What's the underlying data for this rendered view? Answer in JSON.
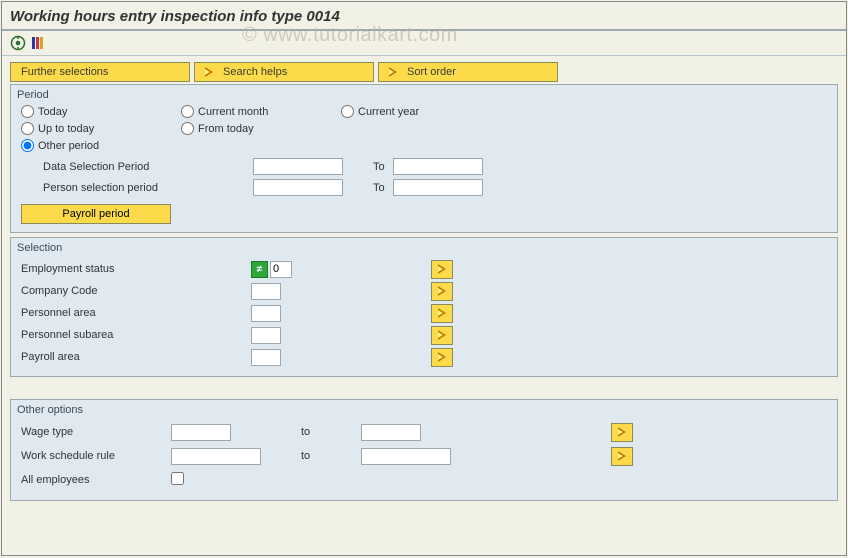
{
  "title": "Working hours entry inspection info type 0014",
  "watermark": "© www.tutorialkart.com",
  "buttons": {
    "further": "Further selections",
    "search_helps": "Search helps",
    "sort_order": "Sort order",
    "payroll": "Payroll period"
  },
  "period": {
    "legend": "Period",
    "today": "Today",
    "current_month": "Current month",
    "current_year": "Current year",
    "up_to_today": "Up to today",
    "from_today": "From today",
    "other_period": "Other period",
    "data_sel": "Data Selection Period",
    "person_sel": "Person selection period",
    "to": "To",
    "selected": "other_period"
  },
  "selection": {
    "legend": "Selection",
    "rows": [
      {
        "label": "Employment status",
        "value": "0",
        "neq": true,
        "arrow": "single"
      },
      {
        "label": "Company Code",
        "value": "",
        "neq": false,
        "arrow": "single"
      },
      {
        "label": "Personnel area",
        "value": "",
        "neq": false,
        "arrow": "single"
      },
      {
        "label": "Personnel subarea",
        "value": "",
        "neq": false,
        "arrow": "single"
      },
      {
        "label": "Payroll area",
        "value": "",
        "neq": false,
        "arrow": "stack"
      }
    ]
  },
  "other": {
    "legend": "Other options",
    "wage_type": "Wage type",
    "wsr": "Work schedule rule",
    "all_emp": "All employees",
    "to": "to"
  }
}
